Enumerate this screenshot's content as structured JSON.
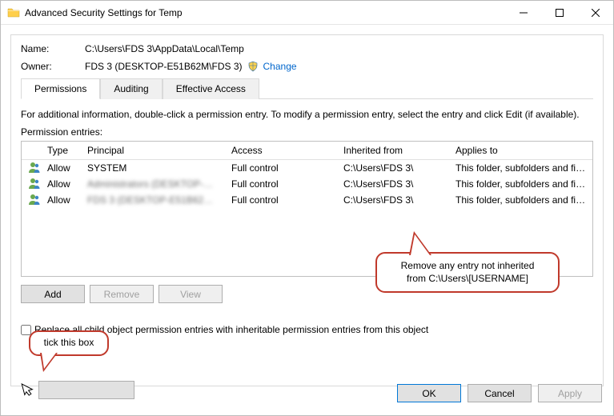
{
  "title": "Advanced Security Settings for Temp",
  "kv": {
    "name_label": "Name:",
    "name_value": "C:\\Users\\FDS 3\\AppData\\Local\\Temp",
    "owner_label": "Owner:",
    "owner_value": "FDS 3 (DESKTOP-E51B62M\\FDS 3)",
    "change_link": "Change"
  },
  "tabs": {
    "permissions": "Permissions",
    "auditing": "Auditing",
    "effective": "Effective Access"
  },
  "info_text": "For additional information, double-click a permission entry. To modify a permission entry, select the entry and click Edit (if available).",
  "entries_label": "Permission entries:",
  "cols": {
    "type": "Type",
    "principal": "Principal",
    "access": "Access",
    "inherited": "Inherited from",
    "applies": "Applies to"
  },
  "rows": [
    {
      "type": "Allow",
      "principal": "SYSTEM",
      "principal_blur": false,
      "access": "Full control",
      "inherited": "C:\\Users\\FDS 3\\",
      "applies": "This folder, subfolders and files"
    },
    {
      "type": "Allow",
      "principal": "Administrators (DESKTOP-E51...",
      "principal_blur": true,
      "access": "Full control",
      "inherited": "C:\\Users\\FDS 3\\",
      "applies": "This folder, subfolders and files"
    },
    {
      "type": "Allow",
      "principal": "FDS 3 (DESKTOP-E51B62M\\FD...",
      "principal_blur": true,
      "access": "Full control",
      "inherited": "C:\\Users\\FDS 3\\",
      "applies": "This folder, subfolders and files"
    }
  ],
  "buttons": {
    "add": "Add",
    "remove": "Remove",
    "view": "View",
    "ok": "OK",
    "cancel": "Cancel",
    "apply": "Apply"
  },
  "checkbox_label": "Replace all child object permission entries with inheritable permission entries from this object",
  "callout1_line1": "Remove any entry not inherited",
  "callout1_line2": "from C:\\Users\\[USERNAME]",
  "callout2_text": "tick this box"
}
